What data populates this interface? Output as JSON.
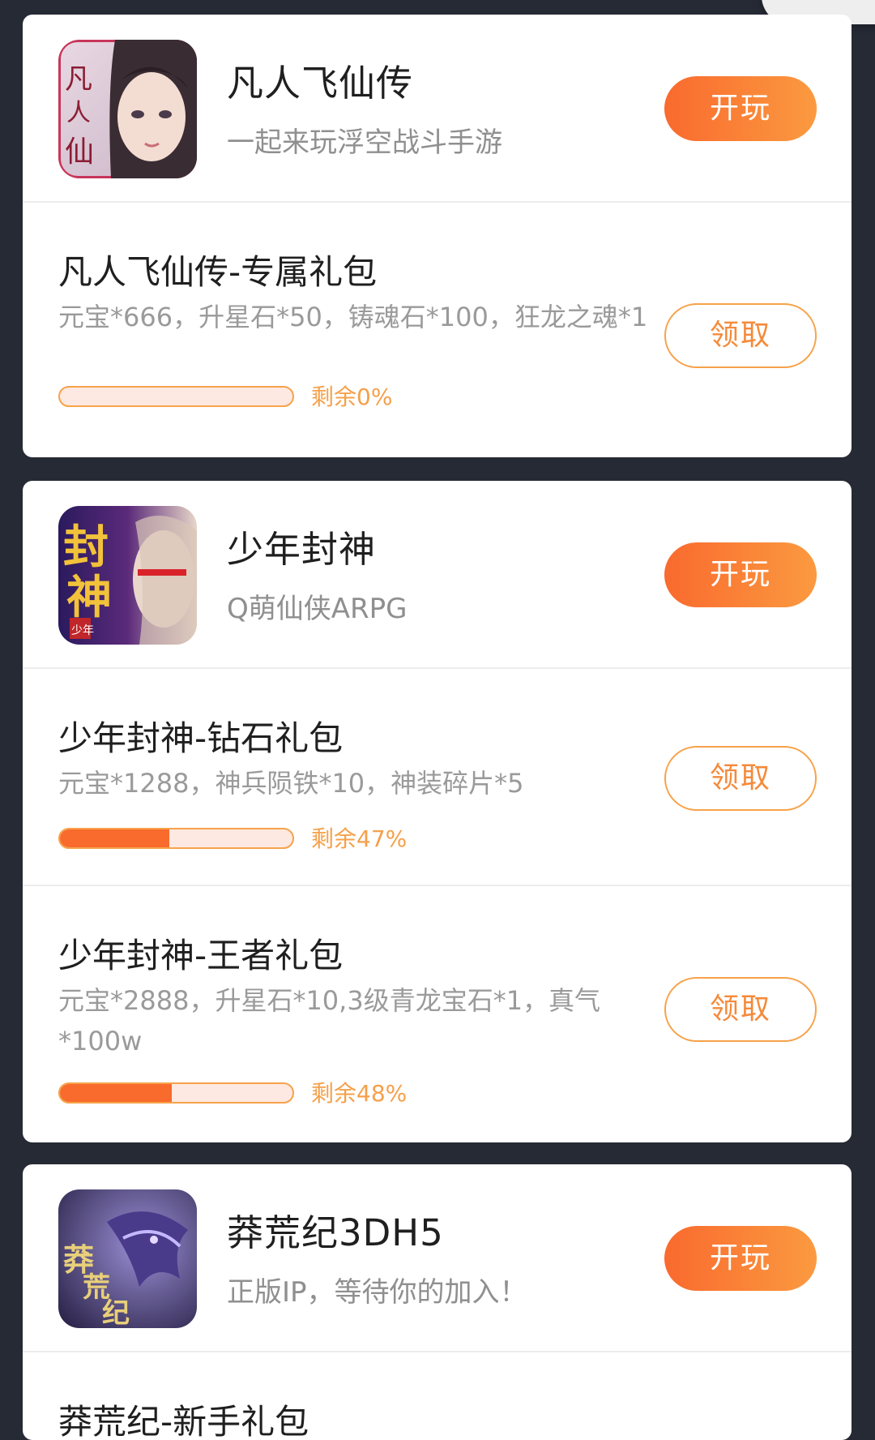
{
  "games": [
    {
      "name": "凡人飞仙传",
      "subtitle": "一起来玩浮空战斗手游",
      "play_label": "开玩",
      "icon": "fanren-feixian-game-icon",
      "gifts": [
        {
          "title": "凡人飞仙传-专属礼包",
          "desc": "元宝*666，升星石*50，铸魂石*100，狂龙之魂*1",
          "claim_label": "领取",
          "remaining": "剩余0%",
          "remaining_fraction": 0.0
        }
      ]
    },
    {
      "name": "少年封神",
      "subtitle": "Q萌仙侠ARPG",
      "play_label": "开玩",
      "icon": "shaonian-fengshen-game-icon",
      "gifts": [
        {
          "title": "少年封神-钻石礼包",
          "desc": "元宝*1288，神兵陨铁*10，神装碎片*5",
          "claim_label": "领取",
          "remaining": "剩余47%",
          "remaining_fraction": 0.47
        },
        {
          "title": "少年封神-王者礼包",
          "desc": "元宝*2888，升星石*10,3级青龙宝石*1，真气*100w",
          "claim_label": "领取",
          "remaining": "剩余48%",
          "remaining_fraction": 0.48
        }
      ]
    },
    {
      "name": "莽荒纪3DH5",
      "subtitle": "正版IP，等待你的加入！",
      "play_label": "开玩",
      "icon": "manghuangji-game-icon",
      "gifts": [
        {
          "title": "莽荒纪-新手礼包"
        }
      ]
    }
  ],
  "colors": {
    "background": "#262a35",
    "accent_orange": "#f86b2c",
    "accent_light_orange": "#f7a24a",
    "progress_track": "#fde9e1"
  }
}
